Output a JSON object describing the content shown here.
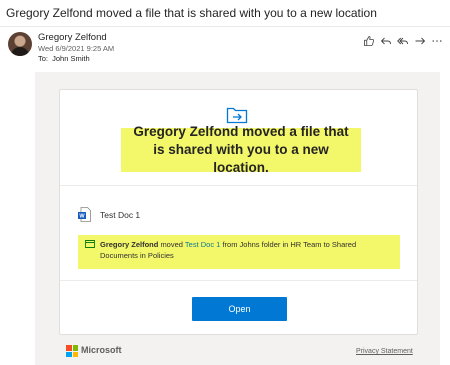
{
  "email": {
    "subject": "Gregory Zelfond moved a file that is shared with you to a new location",
    "sender": "Gregory Zelfond",
    "date": "Wed 6/9/2021 9:25 AM",
    "to_label": "To:",
    "to_name": "John Smith"
  },
  "actions": [
    {
      "icon": "like-icon"
    },
    {
      "icon": "reply-icon"
    },
    {
      "icon": "reply-all-icon"
    },
    {
      "icon": "forward-icon"
    },
    {
      "icon": "more-icon"
    }
  ],
  "card": {
    "headline": "Gregory Zelfond moved a file that is shared with you to a new location.",
    "file_name": "Test Doc 1",
    "activity": {
      "actor": "Gregory Zelfond",
      "verb": "moved",
      "doc": "Test Doc 1",
      "rest": "from Johns folder in HR Team to Shared Documents in Policies"
    },
    "open_label": "Open"
  },
  "footer": {
    "brand": "Microsoft",
    "privacy": "Privacy Statement"
  },
  "colors": {
    "highlight": "#f3f76a",
    "accent": "#0078d4",
    "link": "#0f7b8f"
  }
}
